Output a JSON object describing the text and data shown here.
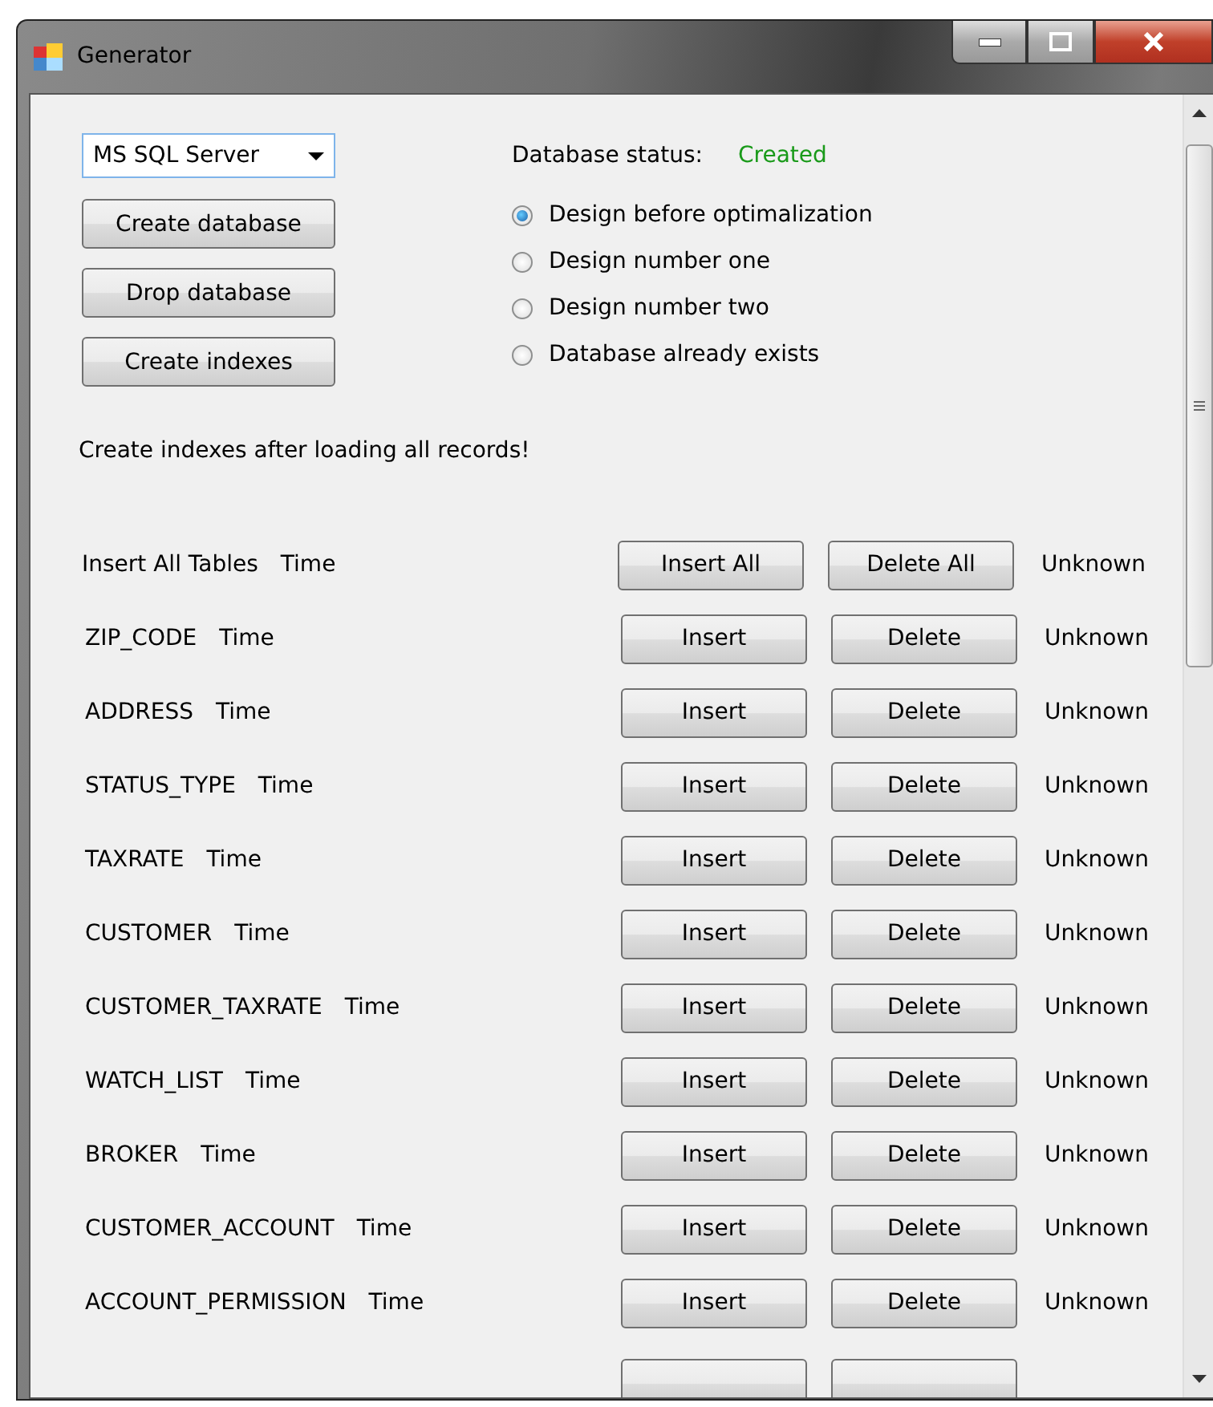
{
  "window": {
    "title": "Generator"
  },
  "provider": {
    "value": "MS SQL Server"
  },
  "actions": [
    "Create database",
    "Drop database",
    "Create indexes"
  ],
  "status": {
    "label": "Database status:",
    "value": "Created"
  },
  "designs": [
    {
      "label": "Design before optimalization",
      "selected": true
    },
    {
      "label": "Design number one",
      "selected": false
    },
    {
      "label": "Design number two",
      "selected": false
    },
    {
      "label": "Database already exists",
      "selected": false
    }
  ],
  "note": "Create indexes after loading all records!",
  "rows": [
    {
      "name": "Insert All Tables",
      "time": "Time",
      "insert": "Insert All",
      "delete": "Delete All",
      "result": "Unknown"
    },
    {
      "name": "ZIP_CODE",
      "time": "Time",
      "insert": "Insert",
      "delete": "Delete",
      "result": "Unknown"
    },
    {
      "name": "ADDRESS",
      "time": "Time",
      "insert": "Insert",
      "delete": "Delete",
      "result": "Unknown"
    },
    {
      "name": "STATUS_TYPE",
      "time": "Time",
      "insert": "Insert",
      "delete": "Delete",
      "result": "Unknown"
    },
    {
      "name": "TAXRATE",
      "time": "Time",
      "insert": "Insert",
      "delete": "Delete",
      "result": "Unknown"
    },
    {
      "name": "CUSTOMER",
      "time": "Time",
      "insert": "Insert",
      "delete": "Delete",
      "result": "Unknown"
    },
    {
      "name": "CUSTOMER_TAXRATE",
      "time": "Time",
      "insert": "Insert",
      "delete": "Delete",
      "result": "Unknown"
    },
    {
      "name": "WATCH_LIST",
      "time": "Time",
      "insert": "Insert",
      "delete": "Delete",
      "result": "Unknown"
    },
    {
      "name": "BROKER",
      "time": "Time",
      "insert": "Insert",
      "delete": "Delete",
      "result": "Unknown"
    },
    {
      "name": "CUSTOMER_ACCOUNT",
      "time": "Time",
      "insert": "Insert",
      "delete": "Delete",
      "result": "Unknown"
    },
    {
      "name": "ACCOUNT_PERMISSION",
      "time": "Time",
      "insert": "Insert",
      "delete": "Delete",
      "result": "Unknown"
    }
  ]
}
